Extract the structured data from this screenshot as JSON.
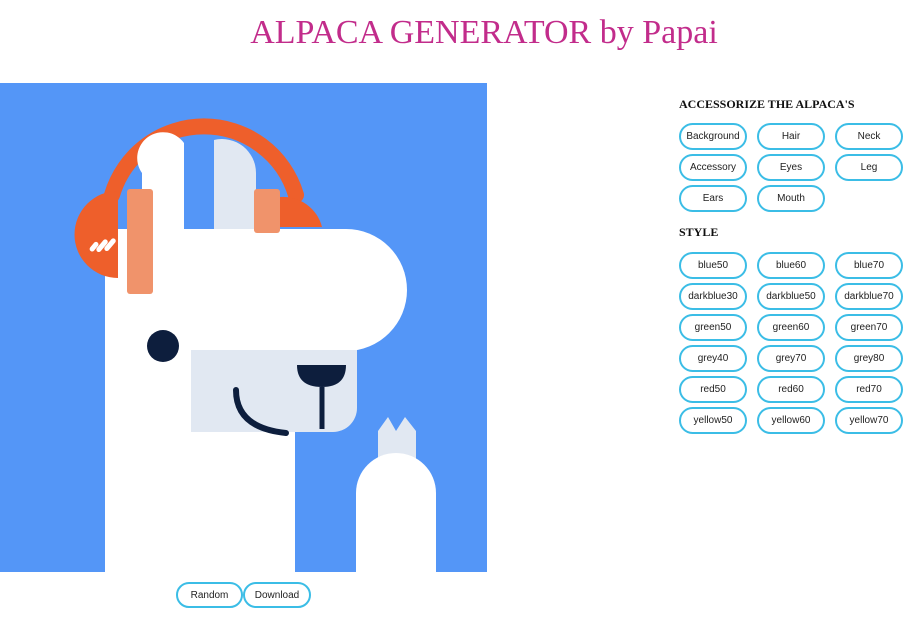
{
  "page": {
    "title": "ALPACA GENERATOR by Papai"
  },
  "colors": {
    "title": "#c22c8b",
    "button_border": "#3bbde6",
    "background": "#5496f7",
    "headphones": "#ee5f2b",
    "headphone_pads": "#f0936b",
    "eye": "#0d1e3d",
    "muzzle": "#e1e8f2"
  },
  "preview": {
    "alt_parts": [
      "background-blue",
      "headphones-accessory",
      "ears",
      "neck",
      "eyes",
      "mouth",
      "leg"
    ]
  },
  "actions": {
    "random_label": "Random",
    "download_label": "Download"
  },
  "accessorize": {
    "heading": "ACCESSORIZE THE ALPACA'S",
    "options": [
      "Background",
      "Hair",
      "Neck",
      "Accessory",
      "Eyes",
      "Leg",
      "Ears",
      "Mouth"
    ]
  },
  "style": {
    "heading": "STYLE",
    "options": [
      "blue50",
      "blue60",
      "blue70",
      "darkblue30",
      "darkblue50",
      "darkblue70",
      "green50",
      "green60",
      "green70",
      "grey40",
      "grey70",
      "grey80",
      "red50",
      "red60",
      "red70",
      "yellow50",
      "yellow60",
      "yellow70"
    ]
  }
}
